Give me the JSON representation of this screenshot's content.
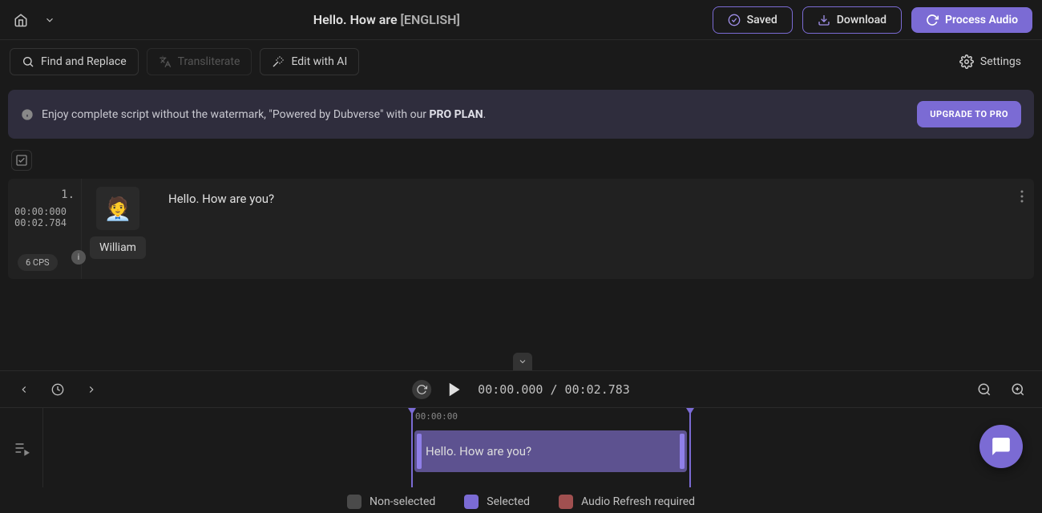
{
  "header": {
    "title_main": "Hello. How are ",
    "title_lang": "[ENGLISH]",
    "saved_label": "Saved",
    "download_label": "Download",
    "process_label": "Process Audio"
  },
  "toolbar": {
    "find_replace": "Find and Replace",
    "transliterate": "Transliterate",
    "edit_ai": "Edit with AI",
    "settings": "Settings"
  },
  "banner": {
    "text_pre": "Enjoy complete script without the watermark, \"Powered by Dubverse\" with our ",
    "text_bold": "PRO PLAN",
    "text_post": ".",
    "upgrade": "UPGRADE TO PRO"
  },
  "segment": {
    "index": "1.",
    "start": "00:00:000",
    "end": "00:02.784",
    "cps": "6 CPS",
    "speaker": "William",
    "text": "Hello. How are you?"
  },
  "player": {
    "current": "00:00.000",
    "sep": " / ",
    "total": "00:02.783"
  },
  "timeline": {
    "timestamp": "00:00:00",
    "clip_text": "Hello. How are you?"
  },
  "legend": {
    "nonselected": "Non-selected",
    "selected": "Selected",
    "refresh": "Audio Refresh required"
  },
  "colors": {
    "nonselected": "#4a4a4a",
    "selected": "#7b6bd4",
    "refresh": "#a05050"
  }
}
